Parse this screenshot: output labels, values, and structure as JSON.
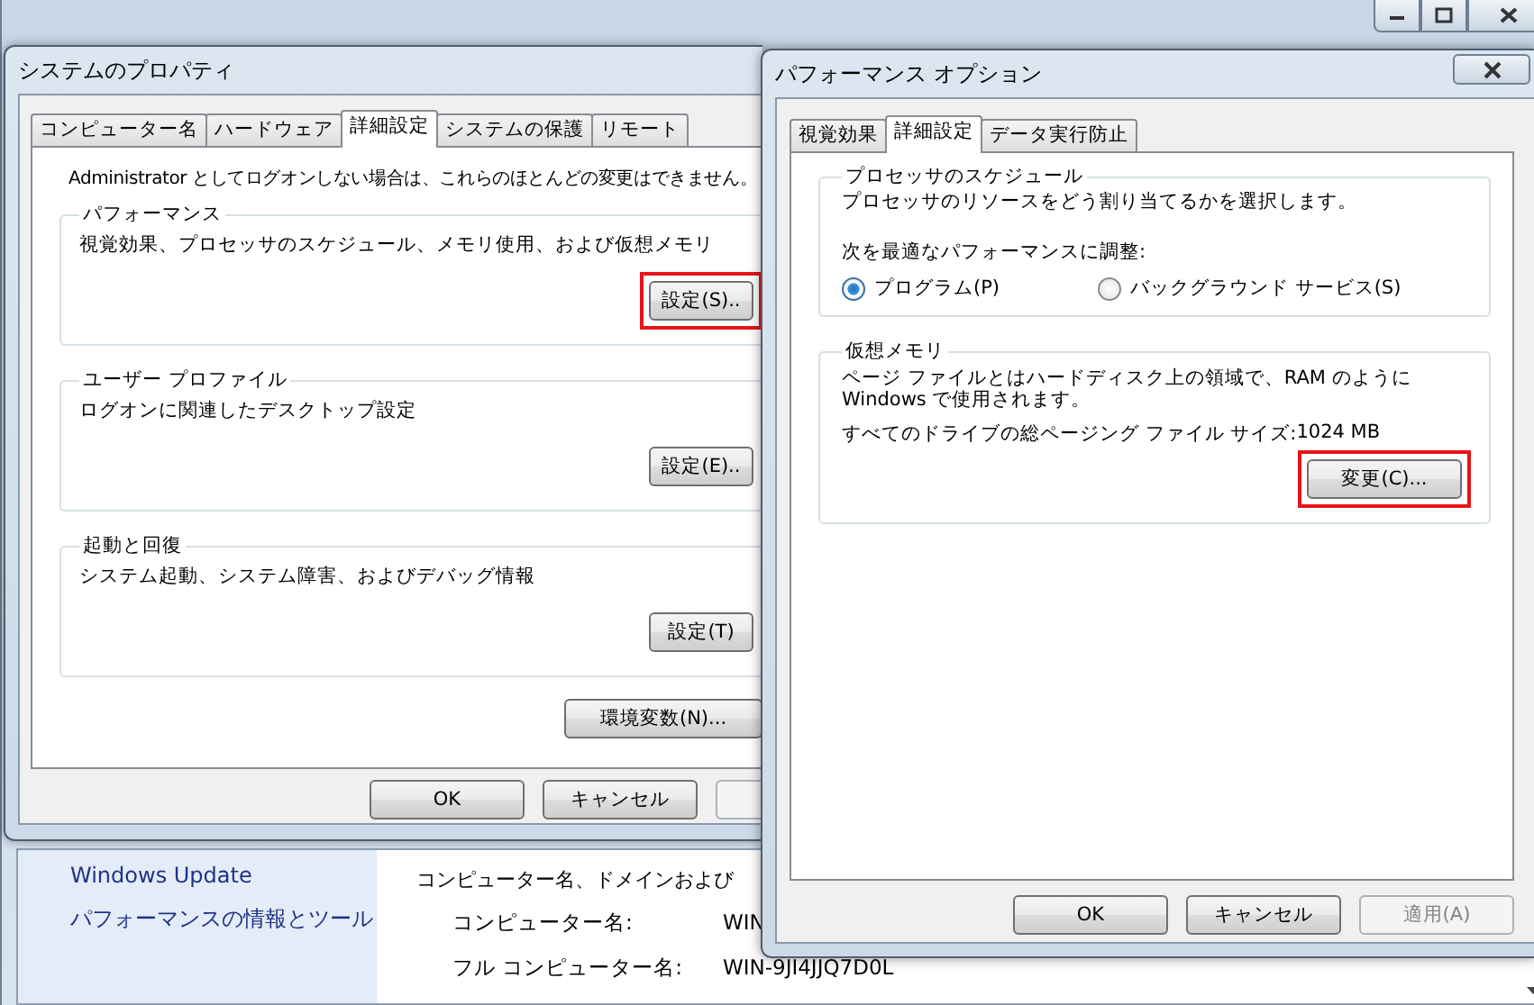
{
  "control_panel": {
    "sidebar": {
      "links": [
        "Windows Update",
        "パフォーマンスの情報とツール"
      ]
    },
    "heading": "コンピューター名、ドメインおよび",
    "rows": [
      {
        "label": "コンピューター名:",
        "value": "WIN"
      },
      {
        "label": "フル コンピューター名:",
        "value": "WIN-9JI4JJQ7D0L"
      }
    ]
  },
  "system_properties": {
    "title": "システムのプロパティ",
    "tabs": [
      {
        "label": "コンピューター名",
        "selected": false
      },
      {
        "label": "ハードウェア",
        "selected": false
      },
      {
        "label": "詳細設定",
        "selected": true
      },
      {
        "label": "システムの保護",
        "selected": false
      },
      {
        "label": "リモート",
        "selected": false
      }
    ],
    "notice": "Administrator としてログオンしない場合は、これらのほとんどの変更はできません。",
    "groups": [
      {
        "title": "パフォーマンス",
        "description": "視覚効果、プロセッサのスケジュール、メモリ使用、および仮想メモリ",
        "button": {
          "label": "設定(S)..",
          "highlighted": true
        }
      },
      {
        "title": "ユーザー プロファイル",
        "description": "ログオンに関連したデスクトップ設定",
        "button": {
          "label": "設定(E)..",
          "highlighted": false
        }
      },
      {
        "title": "起動と回復",
        "description": "システム起動、システム障害、およびデバッグ情報",
        "button": {
          "label": "設定(T)",
          "highlighted": false
        }
      }
    ],
    "env_button": {
      "label": "環境変数(N)..."
    },
    "buttons": [
      {
        "label": "OK",
        "disabled": false
      },
      {
        "label": "キャンセル",
        "disabled": false
      }
    ]
  },
  "performance_options": {
    "title": "パフォーマンス オプション",
    "tabs": [
      {
        "label": "視覚効果",
        "selected": false
      },
      {
        "label": "詳細設定",
        "selected": true
      },
      {
        "label": "データ実行防止",
        "selected": false
      }
    ],
    "scheduling": {
      "title": "プロセッサのスケジュール",
      "description": "プロセッサのリソースをどう割り当てるかを選択します。",
      "prompt": "次を最適なパフォーマンスに調整:",
      "options": [
        {
          "label": "プログラム(P)",
          "selected": true
        },
        {
          "label": "バックグラウンド サービス(S)",
          "selected": false
        }
      ]
    },
    "virtual_memory": {
      "title": "仮想メモリ",
      "description": "ページ ファイルとはハードディスク上の領域で、RAM のように Windows で使用されます。",
      "size_label": "すべてのドライブの総ページング ファイル サイズ:",
      "size_value": "1024 MB",
      "button": {
        "label": "変更(C)...",
        "highlighted": true
      }
    },
    "buttons": [
      {
        "label": "OK",
        "disabled": false
      },
      {
        "label": "キャンセル",
        "disabled": false
      },
      {
        "label": "適用(A)",
        "disabled": true
      }
    ]
  }
}
